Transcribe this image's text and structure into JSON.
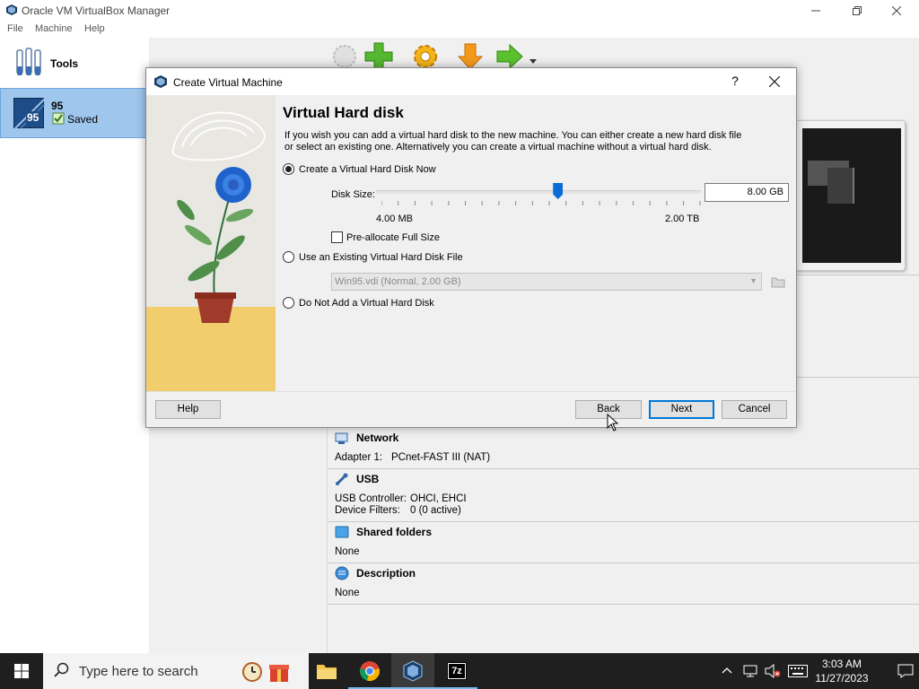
{
  "window": {
    "title": "Oracle VM VirtualBox Manager",
    "menu": [
      "File",
      "Machine",
      "Help"
    ]
  },
  "left_panel": {
    "tools_label": "Tools",
    "vm": {
      "name": "95",
      "icon_badge": "95",
      "state": "Saved"
    }
  },
  "details": {
    "network": {
      "title": "Network",
      "adapter_label": "Adapter 1:",
      "adapter_value": "PCnet-FAST III (NAT)"
    },
    "usb": {
      "title": "USB",
      "controller_label": "USB Controller:",
      "controller_value": "OHCI, EHCI",
      "filters_label": "Device Filters:",
      "filters_value": "0 (0 active)"
    },
    "shared_folders": {
      "title": "Shared folders",
      "value": "None"
    },
    "description": {
      "title": "Description",
      "value": "None"
    }
  },
  "dialog": {
    "title": "Create Virtual Machine",
    "help_glyph": "?",
    "heading": "Virtual Hard disk",
    "description": "If you wish you can add a virtual hard disk to the new machine. You can either create a new hard disk file or select an existing one. Alternatively you can create a virtual machine without a virtual hard disk.",
    "options": {
      "create_now": "Create a Virtual Hard Disk Now",
      "use_existing": "Use an Existing Virtual Hard Disk File",
      "no_disk": "Do Not Add a Virtual Hard Disk"
    },
    "selected_option": "create_now",
    "disk_size_label": "Disk Size:",
    "disk_size_value": "8.00 GB",
    "slider_min_label": "4.00 MB",
    "slider_max_label": "2.00 TB",
    "slider_position_fraction": 0.56,
    "preallocate_label": "Pre-allocate Full Size",
    "preallocate_checked": false,
    "existing_file_value": "Win95.vdi (Normal, 2.00 GB)",
    "buttons": {
      "help": "Help",
      "back": "Back",
      "next": "Next",
      "cancel": "Cancel"
    }
  },
  "taskbar": {
    "search_placeholder": "Type here to search",
    "time": "3:03 AM",
    "date": "11/27/2023",
    "apps": [
      "file-explorer",
      "chrome",
      "virtualbox",
      "7-zip"
    ]
  },
  "colors": {
    "selection_bg": "#9fc7ee",
    "accent_blue": "#0078d7",
    "taskbar_bg": "#1f1f1f"
  }
}
